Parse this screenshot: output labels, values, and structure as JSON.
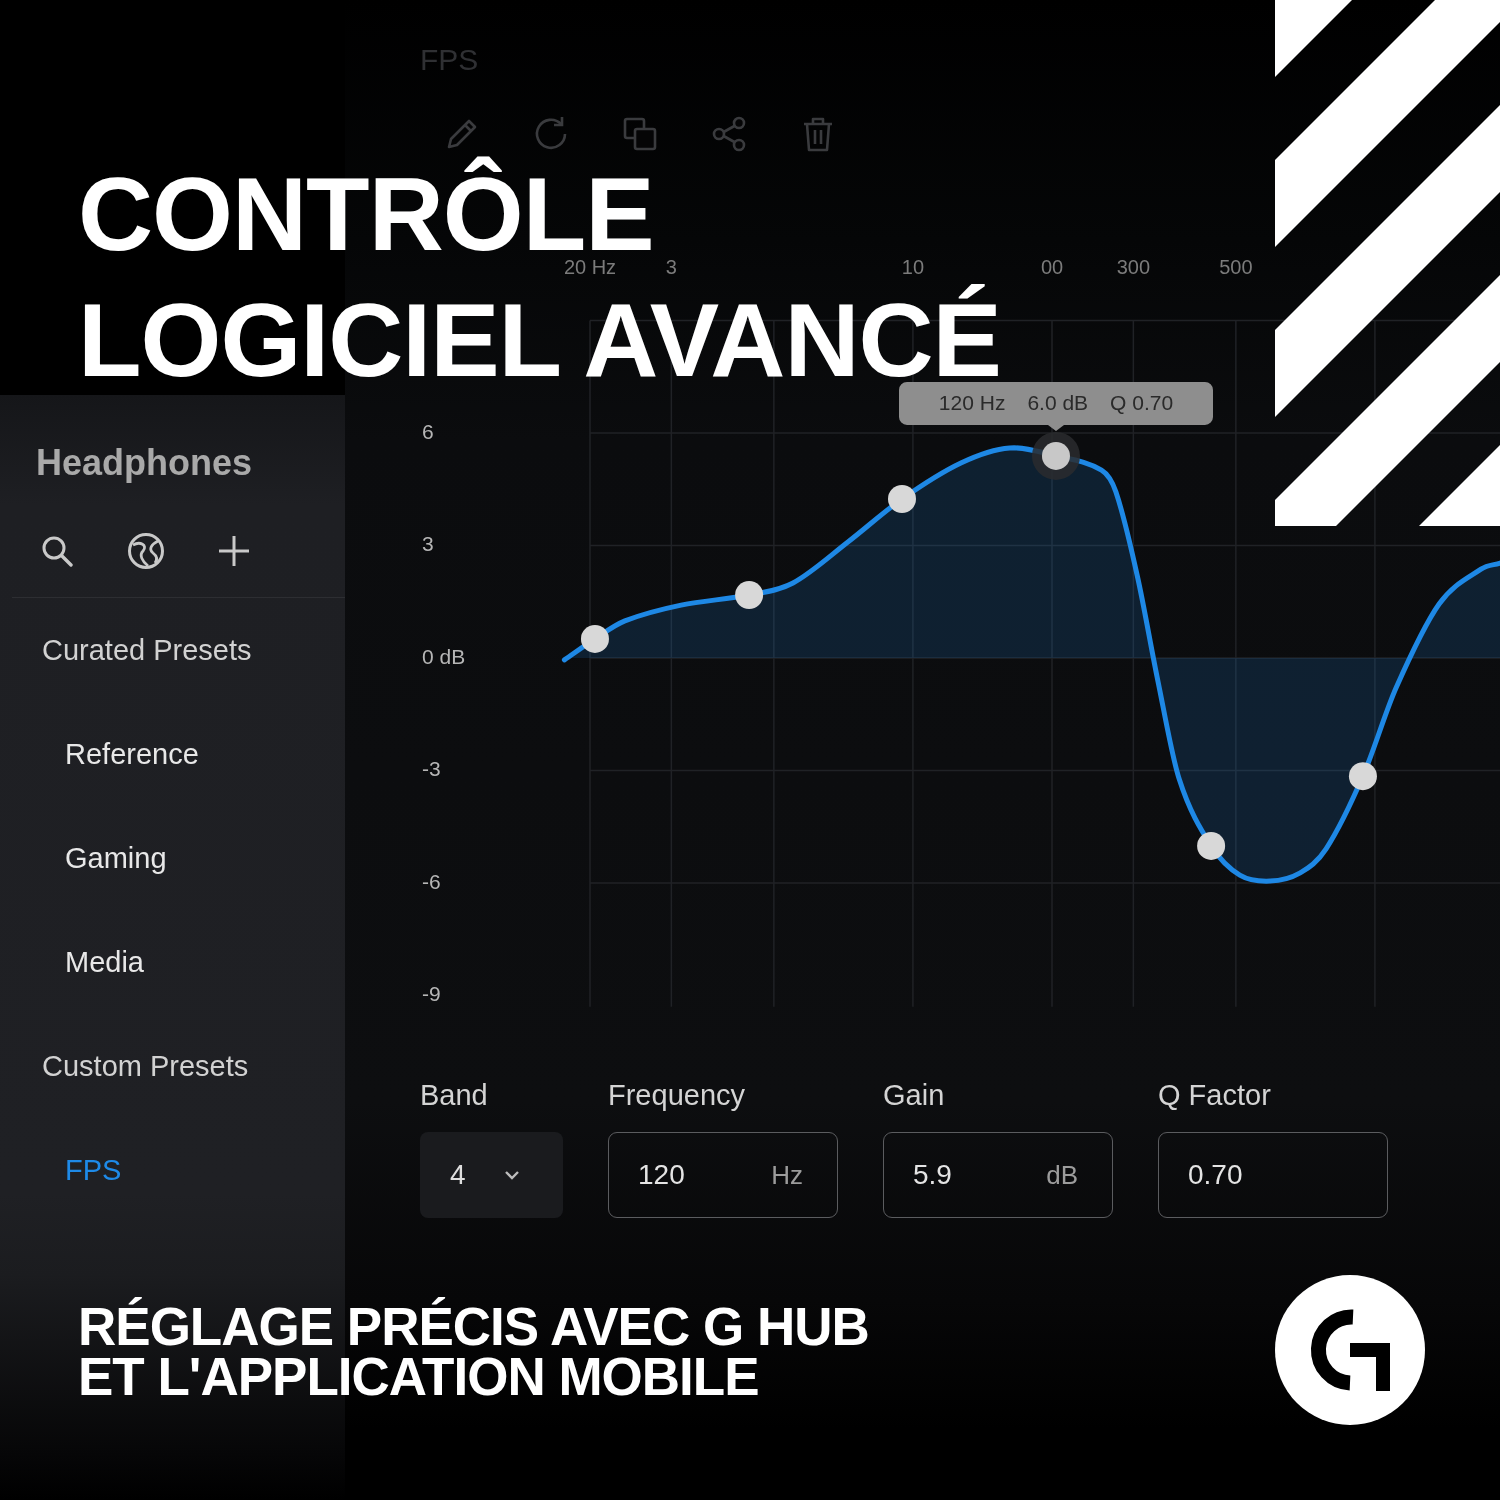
{
  "preset_title": "FPS",
  "headline": [
    "CONTRÔLE",
    "LOGICIEL AVANCÉ"
  ],
  "sidebar": {
    "title": "Headphones",
    "sections": [
      {
        "heading": "Curated Presets",
        "items": [
          {
            "label": "Reference",
            "selected": false
          },
          {
            "label": "Gaming",
            "selected": false
          },
          {
            "label": "Media",
            "selected": false
          }
        ]
      },
      {
        "heading": "Custom Presets",
        "items": [
          {
            "label": "FPS",
            "selected": true
          }
        ]
      }
    ]
  },
  "equalizer": {
    "x_labels": [
      "20 Hz",
      "3",
      "10",
      "00",
      "300",
      "500"
    ],
    "y_labels": [
      "6",
      "3",
      "0 dB",
      "-3",
      "-6",
      "-9"
    ],
    "handles": [
      {
        "selected": false
      },
      {
        "selected": false
      },
      {
        "selected": false
      },
      {
        "selected": true
      },
      {
        "selected": false
      },
      {
        "selected": false
      }
    ],
    "tooltip": [
      "120 Hz",
      "6.0 dB",
      "Q 0.70"
    ]
  },
  "band_controls": [
    {
      "kind": "dropdown",
      "label": "Band",
      "value": "4"
    },
    {
      "kind": "input",
      "label": "Frequency",
      "value": "120",
      "unit": "Hz"
    },
    {
      "kind": "input",
      "label": "Gain",
      "value": "5.9",
      "unit": "dB"
    },
    {
      "kind": "input",
      "label": "Q Factor",
      "value": "0.70"
    }
  ],
  "caption": "RÉGLAGE PRÉCIS AVEC G HUB ET L'APPLICATION MOBILE"
}
